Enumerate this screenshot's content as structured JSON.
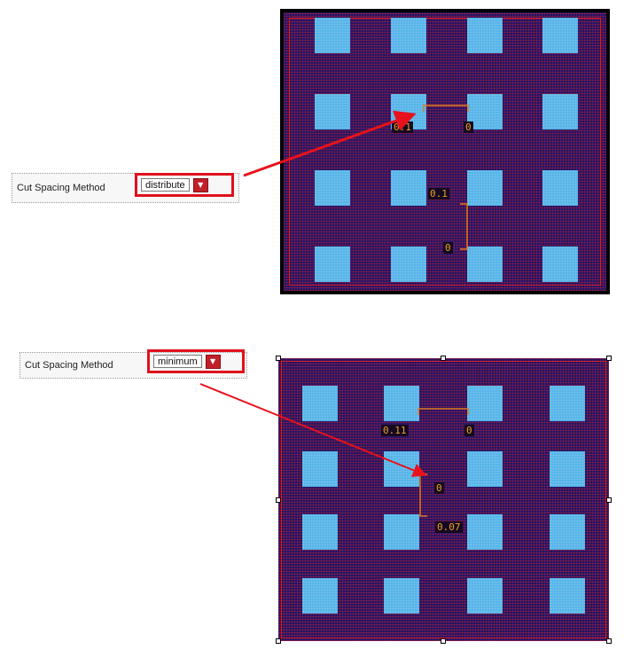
{
  "examples": [
    {
      "property_label": "Cut Spacing Method",
      "selected_value": "distribute",
      "dimensions": [
        "0.1",
        "0",
        "0.1",
        "0"
      ]
    },
    {
      "property_label": "Cut Spacing Method",
      "selected_value": "minimum",
      "dimensions": [
        "0.11",
        "0",
        "0",
        "0.07"
      ]
    }
  ],
  "colors": {
    "highlight": "#e0101c",
    "cut": "#56b4e8",
    "dimension": "#f0a020",
    "arrow": "#e8121c"
  },
  "icons": [
    "dropdown-arrow-icon"
  ]
}
